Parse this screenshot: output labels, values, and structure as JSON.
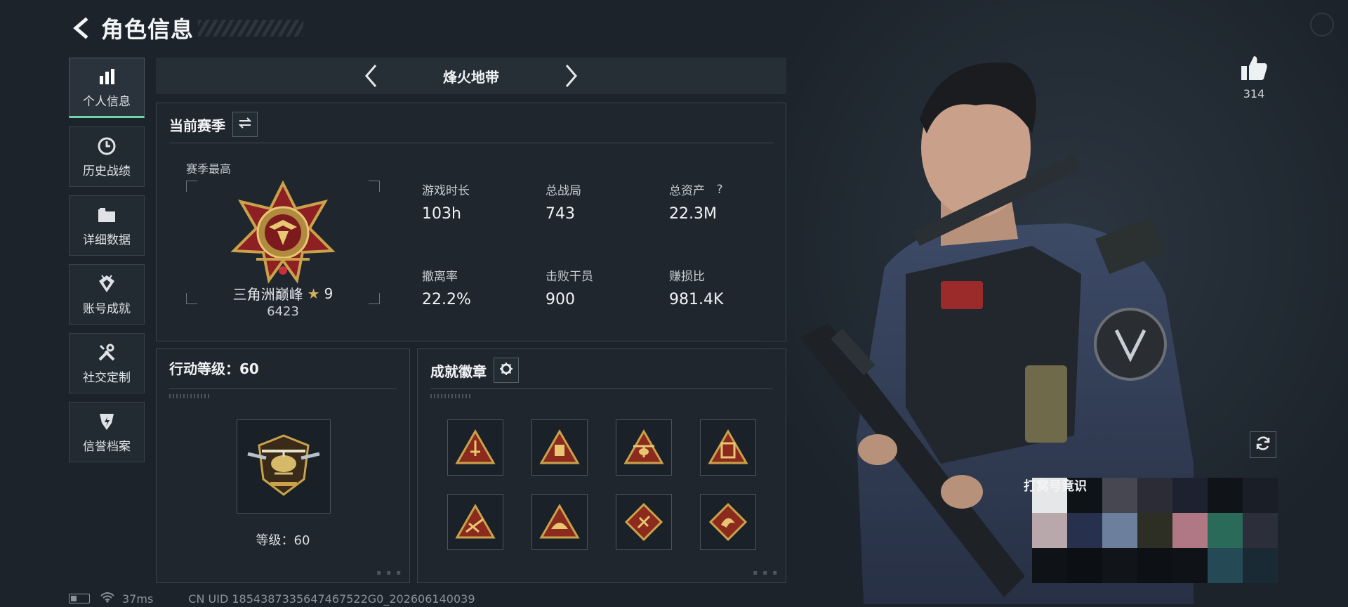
{
  "header": {
    "title": "角色信息"
  },
  "sidebar": {
    "items": [
      {
        "label": "个人信息",
        "icon": "bar-chart-icon",
        "active": true
      },
      {
        "label": "历史战绩",
        "icon": "clock-history-icon"
      },
      {
        "label": "详细数据",
        "icon": "folder-icon"
      },
      {
        "label": "账号成就",
        "icon": "achievement-badge-icon"
      },
      {
        "label": "社交定制",
        "icon": "tools-icon"
      },
      {
        "label": "信誉档案",
        "icon": "shield-icon"
      }
    ]
  },
  "mode": {
    "title": "烽火地带"
  },
  "season": {
    "title": "当前赛季",
    "subtitle": "赛季最高",
    "rank_name": "三角洲巅峰",
    "rank_star": "★",
    "rank_stars": "9",
    "rank_score": "6423",
    "stats": [
      {
        "label": "游戏时长",
        "value": "103h"
      },
      {
        "label": "总战局",
        "value": "743"
      },
      {
        "label": "总资产",
        "value": "22.3M",
        "help": "?"
      },
      {
        "label": "撤离率",
        "value": "22.2%"
      },
      {
        "label": "击败干员",
        "value": "900"
      },
      {
        "label": "赚损比",
        "value": "981.4K"
      }
    ]
  },
  "level": {
    "title": "行动等级：60",
    "caption": "等级：60"
  },
  "achievements": {
    "title": "成就徽章",
    "count_slots": 8
  },
  "like": {
    "count": "314"
  },
  "mosaic": {
    "label": "打窝号竟识"
  },
  "status": {
    "ping": "37ms",
    "uid": "CN UID 1854387335647467522G0_202606140039"
  },
  "colors": {
    "accent": "#6fd3a6",
    "gold": "#c9a24a",
    "panel": "#1f262d",
    "bg": "#1c232b"
  }
}
